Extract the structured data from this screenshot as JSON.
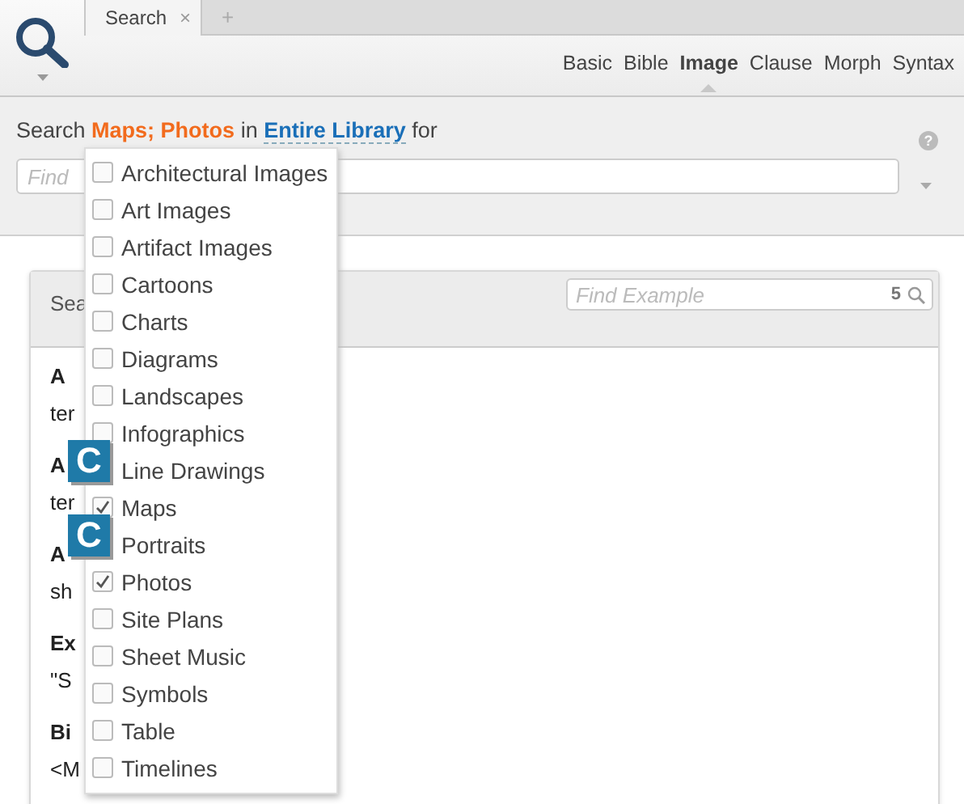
{
  "header": {
    "tab": {
      "label": "Search",
      "close": "×"
    },
    "new_tab": "+",
    "search_types": [
      {
        "label": "Basic",
        "selected": false
      },
      {
        "label": "Bible",
        "selected": false
      },
      {
        "label": "Image",
        "selected": true
      },
      {
        "label": "Clause",
        "selected": false
      },
      {
        "label": "Morph",
        "selected": false
      },
      {
        "label": "Syntax",
        "selected": false
      }
    ]
  },
  "query": {
    "prefix": "Search",
    "types": "Maps; Photos",
    "in": "in",
    "scope": "Entire Library",
    "suffix": "for",
    "help": "?",
    "placeholder": "Find"
  },
  "panel": {
    "title": "Sea",
    "find": {
      "placeholder": "Find Example",
      "count": "5"
    },
    "entries": [
      {
        "heading": "A",
        "text": "ter"
      },
      {
        "heading": "A",
        "text": "ter"
      },
      {
        "heading": "A",
        "text": "sh"
      },
      {
        "heading": "Ex",
        "text": "\"S"
      },
      {
        "heading": "Bi",
        "text": "<M"
      }
    ]
  },
  "dropdown": {
    "items": [
      {
        "label": "Architectural Images",
        "checked": false
      },
      {
        "label": "Art Images",
        "checked": false
      },
      {
        "label": "Artifact Images",
        "checked": false
      },
      {
        "label": "Cartoons",
        "checked": false
      },
      {
        "label": "Charts",
        "checked": false
      },
      {
        "label": "Diagrams",
        "checked": false
      },
      {
        "label": "Landscapes",
        "checked": false
      },
      {
        "label": "Infographics",
        "checked": false
      },
      {
        "label": "Line Drawings",
        "badge": "C"
      },
      {
        "label": "Maps",
        "checked": true
      },
      {
        "label": "Portraits",
        "badge": "C"
      },
      {
        "label": "Photos",
        "checked": true
      },
      {
        "label": "Site Plans",
        "checked": false
      },
      {
        "label": "Sheet Music",
        "checked": false
      },
      {
        "label": "Symbols",
        "checked": false
      },
      {
        "label": "Table",
        "checked": false
      },
      {
        "label": "Timelines",
        "checked": false
      }
    ]
  }
}
